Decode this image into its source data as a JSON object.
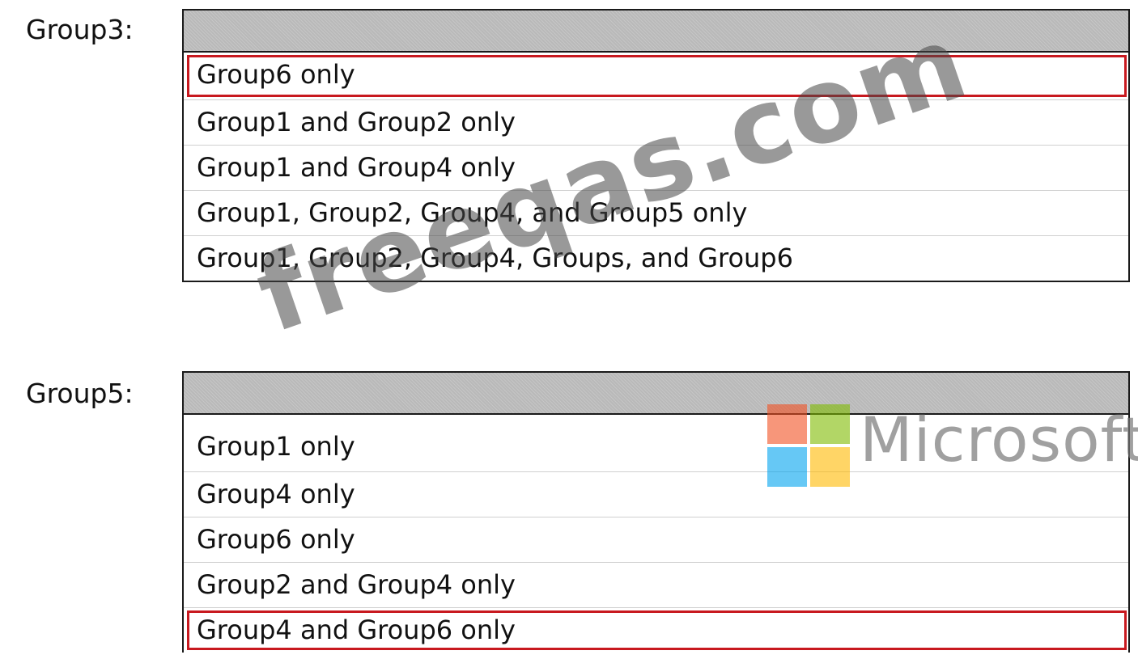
{
  "groups": [
    {
      "label": "Group3:",
      "options": [
        "Group6 only",
        "Group1 and Group2 only",
        "Group1 and Group4 only",
        "Group1, Group2, Group4, and Group5 only",
        "Group1, Group2, Group4, Groups, and Group6"
      ],
      "selected_index": 0
    },
    {
      "label": "Group5:",
      "options": [
        "Group1 only",
        "Group4 only",
        "Group6 only",
        "Group2 and Group4 only",
        "Group4 and Group6 only"
      ],
      "selected_index": 4
    }
  ],
  "watermark": {
    "text": "freeqas.com"
  },
  "brand": {
    "name": "Microsoft",
    "logo_icon": "microsoft-logo-icon",
    "colors": {
      "red": "#f25022",
      "green": "#7fba00",
      "blue": "#00a4ef",
      "yellow": "#ffb900"
    }
  },
  "colors": {
    "selection_border": "#c8191f",
    "header_fill": "#b9b9b9"
  }
}
